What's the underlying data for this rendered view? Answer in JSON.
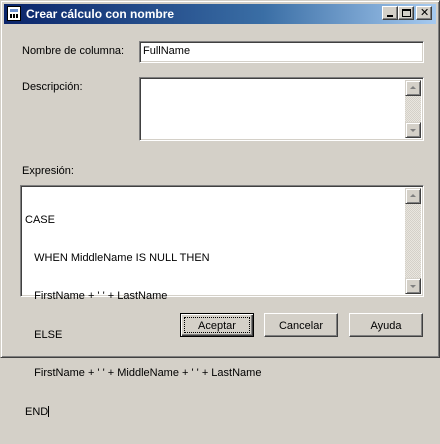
{
  "window": {
    "title": "Crear cálculo con nombre",
    "icon": "calculator-icon",
    "caption_buttons": {
      "minimize": "minimize-icon",
      "maximize": "maximize-icon",
      "close": "close-icon"
    }
  },
  "form": {
    "column_name_label": "Nombre de columna:",
    "column_name_value": "FullName",
    "description_label": "Descripción:",
    "description_value": "",
    "expression_label": "Expresión:",
    "expression_lines": [
      "CASE",
      "   WHEN MiddleName IS NULL THEN",
      "   FirstName + ' ' + LastName",
      "   ELSE",
      "   FirstName + ' ' + MiddleName + ' ' + LastName",
      "END"
    ]
  },
  "buttons": {
    "accept": "Aceptar",
    "cancel": "Cancelar",
    "help": "Ayuda"
  },
  "colors": {
    "face": "#d4d0c8",
    "title_start": "#0a246a",
    "title_end": "#a6caf0"
  }
}
